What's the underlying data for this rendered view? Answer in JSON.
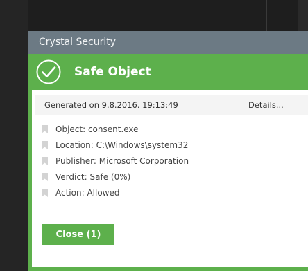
{
  "window": {
    "title": "Crystal Security"
  },
  "header": {
    "icon": "checkmark-circle-icon",
    "title": "Safe Object"
  },
  "generated": {
    "text": "Generated on 9.8.2016. 19:13:49",
    "details_label": "Details..."
  },
  "info": [
    {
      "icon": "bookmark-icon",
      "label": "Object: consent.exe"
    },
    {
      "icon": "bookmark-icon",
      "label": "Location: C:\\Windows\\system32"
    },
    {
      "icon": "bookmark-icon",
      "label": "Publisher: Microsoft Corporation"
    },
    {
      "icon": "bookmark-icon",
      "label": "Verdict: Safe (0%)"
    },
    {
      "icon": "bookmark-icon",
      "label": "Action: Allowed"
    }
  ],
  "actions": {
    "close_label": "Close (1)"
  },
  "colors": {
    "accent": "#5db04c",
    "titlebar": "#6c7a84",
    "background": "#1e1e1e"
  }
}
